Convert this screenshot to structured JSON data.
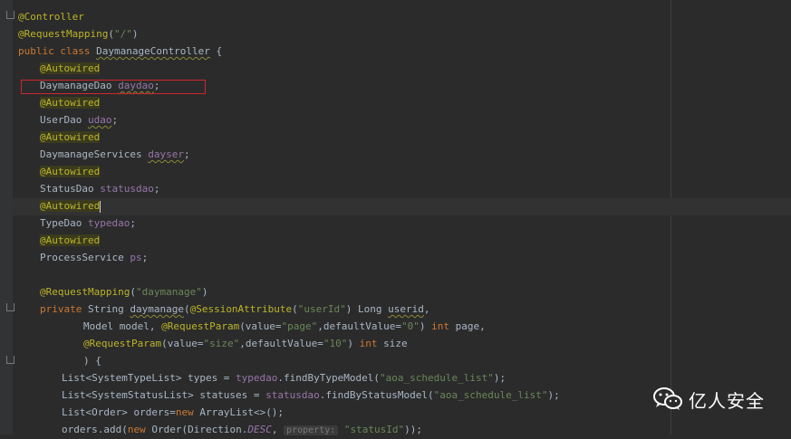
{
  "watermark": {
    "text": "亿人安全"
  },
  "inlay_hint": {
    "label": "property:"
  },
  "code": {
    "l1": "@Controller",
    "l2_ann": "@RequestMapping",
    "l2_p1": "(",
    "l2_str": "\"/\"",
    "l2_p2": ")",
    "l3_kw": "public class ",
    "l3_cls": "DaymanageController",
    "l3_end": " {",
    "autowired": "@Autowired",
    "f1_type": "DaymanageDao ",
    "f1_name": "daydao",
    "f2_type": "UserDao ",
    "f2_name": "udao",
    "f3_type": "DaymanageServices ",
    "f3_name": "dayser",
    "f4_type": "StatusDao ",
    "f4_name": "statusdao",
    "f5_type": "TypeDao ",
    "f5_name": "typedao",
    "f6_type": "ProcessService ",
    "f6_name": "ps",
    "semi": ";",
    "m_ann": "@RequestMapping",
    "m_p1": "(",
    "m_str": "\"daymanage\"",
    "m_p2": ")",
    "sig_kw": "private ",
    "sig_type": "String ",
    "sig_name": "daymanage",
    "sig_p": "(",
    "sig_ann": "@SessionAttribute",
    "sig_p2": "(",
    "sig_str": "\"userId\"",
    "sig_rest": ") Long ",
    "sig_param": "userid",
    "sig_comma": ",",
    "p2_a": "Model model, ",
    "p2_ann": "@RequestParam",
    "p2_b": "(value=",
    "p2_s1": "\"page\"",
    "p2_c": ",defaultValue=",
    "p2_s2": "\"0\"",
    "p2_d": ") ",
    "p2_kw": "int",
    "p2_e": " page,",
    "p3_ann": "@RequestParam",
    "p3_b": "(value=",
    "p3_s1": "\"size\"",
    "p3_c": ",defaultValue=",
    "p3_s2": "\"10\"",
    "p3_d": ") ",
    "p3_kw": "int",
    "p3_e": " size",
    "p4": ") {",
    "b1_a": "List<SystemTypeList> types = ",
    "b1_f": "typedao",
    "b1_b": ".findByTypeModel(",
    "b1_s": "\"aoa_schedule_list\"",
    "b1_c": ");",
    "b2_a": "List<SystemStatusList> statuses = ",
    "b2_f": "statusdao",
    "b2_b": ".findByStatusModel(",
    "b2_s": "\"aoa_schedule_list\"",
    "b2_c": ");",
    "b3_a": "List<Order> orders=",
    "b3_kw": "new",
    "b3_b": " ArrayList<>();",
    "b4_a": "orders.add(",
    "b4_kw": "new",
    "b4_b": " Order(Direction.",
    "b4_c": "DESC",
    "b4_d": ", ",
    "b4_s": "\"statusId\"",
    "b4_e": "));"
  }
}
